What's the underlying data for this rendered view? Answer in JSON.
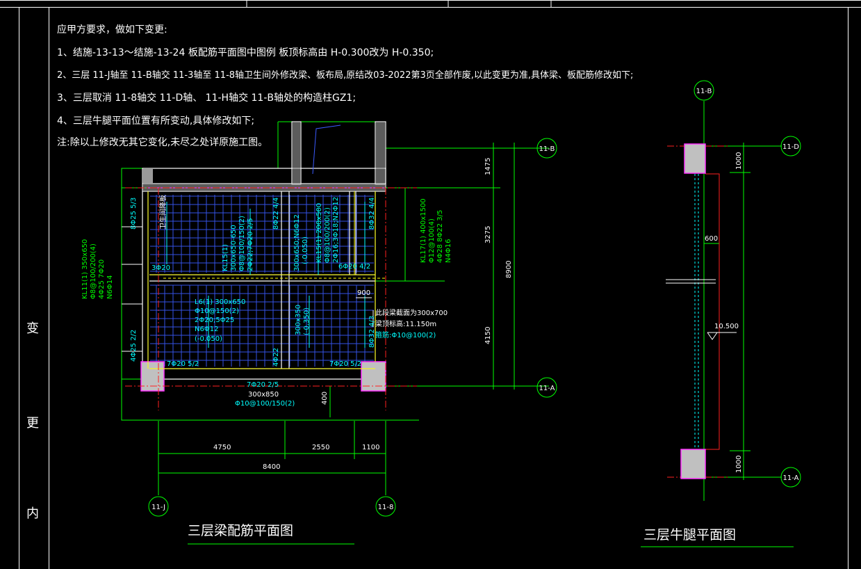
{
  "colors": {
    "background": "#000000",
    "frame": "#ffffff",
    "axis": "#00ff00",
    "dim": "#00ff00",
    "rebar": "#00ffff",
    "beam_edge": "#ffffff",
    "column_fill": "#c0c0c0",
    "magenta": "#ff33ff",
    "red": "#ff2020",
    "yellow": "#ffff00",
    "blue": "#3b5bff"
  },
  "side_label": [
    "变",
    "更",
    "内"
  ],
  "notes": [
    "应甲方要求，做如下变更:",
    "1、结施-13-13～结施-13-24 板配筋平面图中图例        板顶标高由 H-0.300改为 H-0.350;",
    "2、三层 11-J轴至  11-B轴交  11-3轴至  11-8轴卫生间外修改梁、板布局,原结改03-2022第3页全部作废,以此变更为准,具体梁、板配筋修改如下;",
    "3、三层取消  11-8轴交  11-D轴、 11-H轴交   11-B轴处的构造柱GZ1;",
    "4、三层牛腿平面位置有所变动,具体修改如下;",
    "注:除以上修改无其它变化,未尽之处详原施工图。"
  ],
  "plan": {
    "title": "三层梁配筋平面图",
    "axes": {
      "left_bottom": "11-J",
      "right_bottom": "11-8",
      "right_top": "11-B",
      "right_low": "11-A"
    },
    "dims_h": [
      "4750",
      "2550",
      "1100",
      "8400"
    ],
    "dims_v": [
      "1475",
      "3275",
      "4150",
      "8900",
      "400"
    ],
    "beam_labels": {
      "kl11": [
        "KL11(1) 350x650",
        "Φ8@100/200(4)",
        "4Φ25 7Φ20",
        "N6Φ14"
      ],
      "kl15": [
        "KL15(1)",
        "300x650-650",
        "Φ8@100/150(2)",
        "2Φ22;7Φ20 2/5"
      ],
      "kl15b": [
        "KL15(1) 200x500",
        "Φ8@100/200(2)",
        "2Φ16;3Φ18;N2Φ12"
      ],
      "kl17": [
        "KL17(1) 400x1500",
        "Φ12@100(4)",
        "4Φ28 8Φ22 3/5",
        "N4Φ16"
      ],
      "l6": [
        "L6(1) 300x650",
        "Φ10@150(2)",
        "2Φ20;5Φ25",
        "N6Φ12",
        "(-0.050)"
      ],
      "mid1": [
        "300x650;N6Φ12",
        "(-0.050)"
      ],
      "mid2": [
        "300x350",
        "(-0.350)"
      ],
      "bottom": [
        "7Φ20 2/5",
        "300x850",
        "Φ10@100/150(2)"
      ],
      "note_right": [
        "此段梁截面为300x700",
        "梁顶标高:11.150m",
        "箍筋:Φ10@100(2)"
      ],
      "misc": [
        "8Φ25 5/3",
        "8Φ22 4/4",
        "8Φ32 4/4",
        "3Φ20",
        "6Φ20 4/2",
        "7Φ20 5/2",
        "7Φ20 5/2",
        "4Φ25 2/2",
        "4Φ22",
        "8Φ32 4/3",
        "900",
        "卫生间降板"
      ]
    }
  },
  "corbel": {
    "title": "三层牛腿平面图",
    "axes": {
      "top": "11-B",
      "right_top": "11-D",
      "right_bottom": "11-A"
    },
    "dims": [
      "1000",
      "600",
      "10.500",
      "1000"
    ]
  }
}
